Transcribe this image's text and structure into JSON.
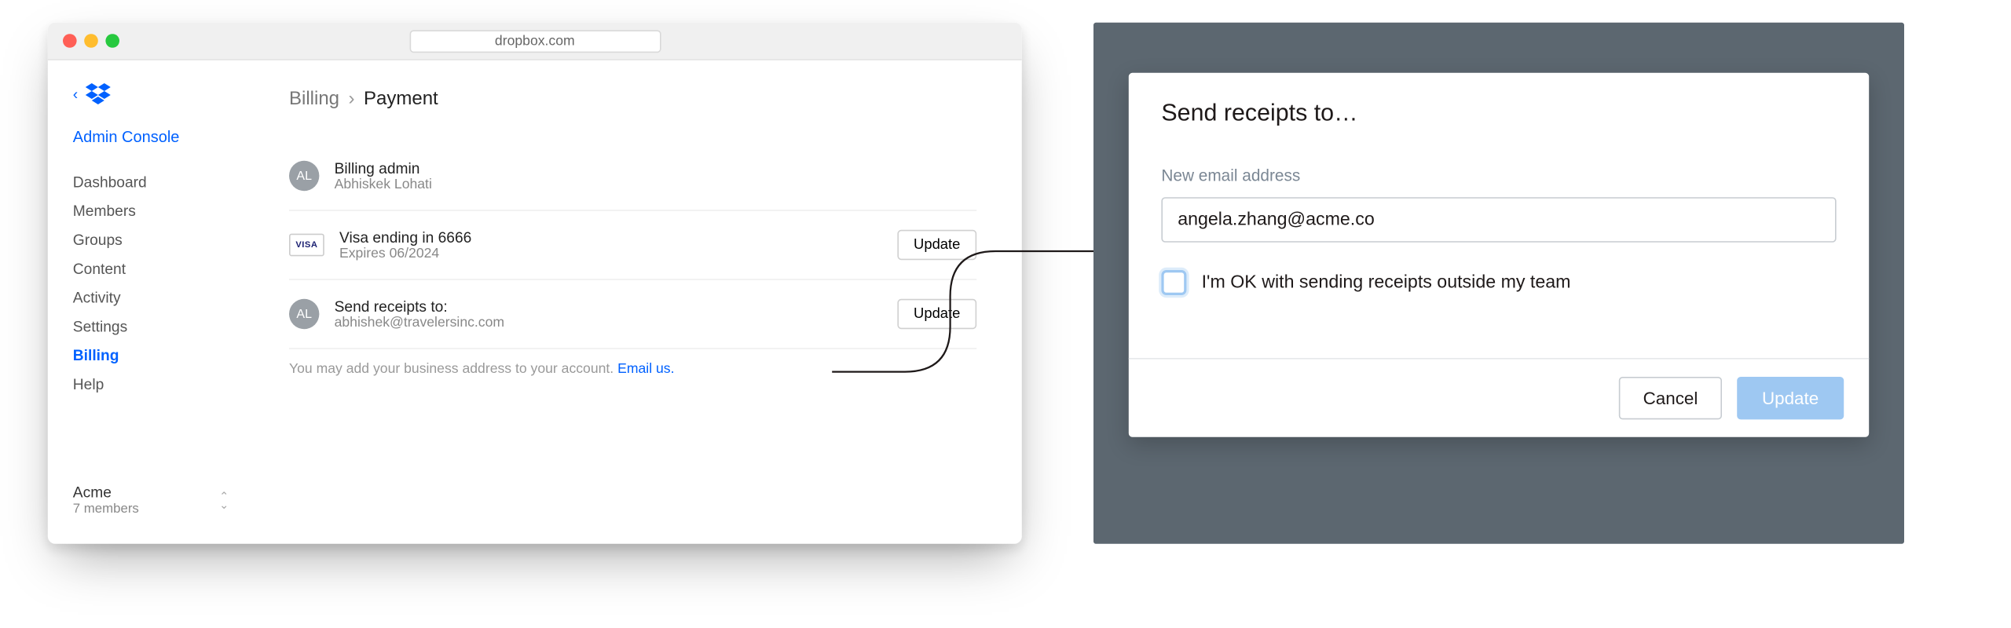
{
  "browser": {
    "url": "dropbox.com"
  },
  "sidebar": {
    "title": "Admin Console",
    "items": [
      {
        "label": "Dashboard"
      },
      {
        "label": "Members"
      },
      {
        "label": "Groups"
      },
      {
        "label": "Content"
      },
      {
        "label": "Activity"
      },
      {
        "label": "Settings"
      },
      {
        "label": "Billing"
      },
      {
        "label": "Help"
      }
    ],
    "active_index": 6,
    "teamswitcher": {
      "name": "Acme",
      "sub": "7 members"
    }
  },
  "breadcrumb": {
    "root": "Billing",
    "leaf": "Payment"
  },
  "rows": {
    "admin": {
      "avatar": "AL",
      "title": "Billing admin",
      "sub": "Abhiskek Lohati"
    },
    "card": {
      "badge": "VISA",
      "title": "Visa ending in 6666",
      "sub": "Expires 06/2024",
      "action": "Update"
    },
    "receipts": {
      "avatar": "AL",
      "title": "Send receipts to:",
      "sub": "abhishek@travelersinc.com",
      "action": "Update"
    }
  },
  "helper": {
    "text": "You may add your business address to your account. ",
    "link": "Email us."
  },
  "dialog": {
    "title": "Send receipts to…",
    "field_label": "New email address",
    "field_value": "angela.zhang@acme.co",
    "checkbox_label": "I'm OK with sending receipts outside my team",
    "cancel": "Cancel",
    "update": "Update"
  }
}
